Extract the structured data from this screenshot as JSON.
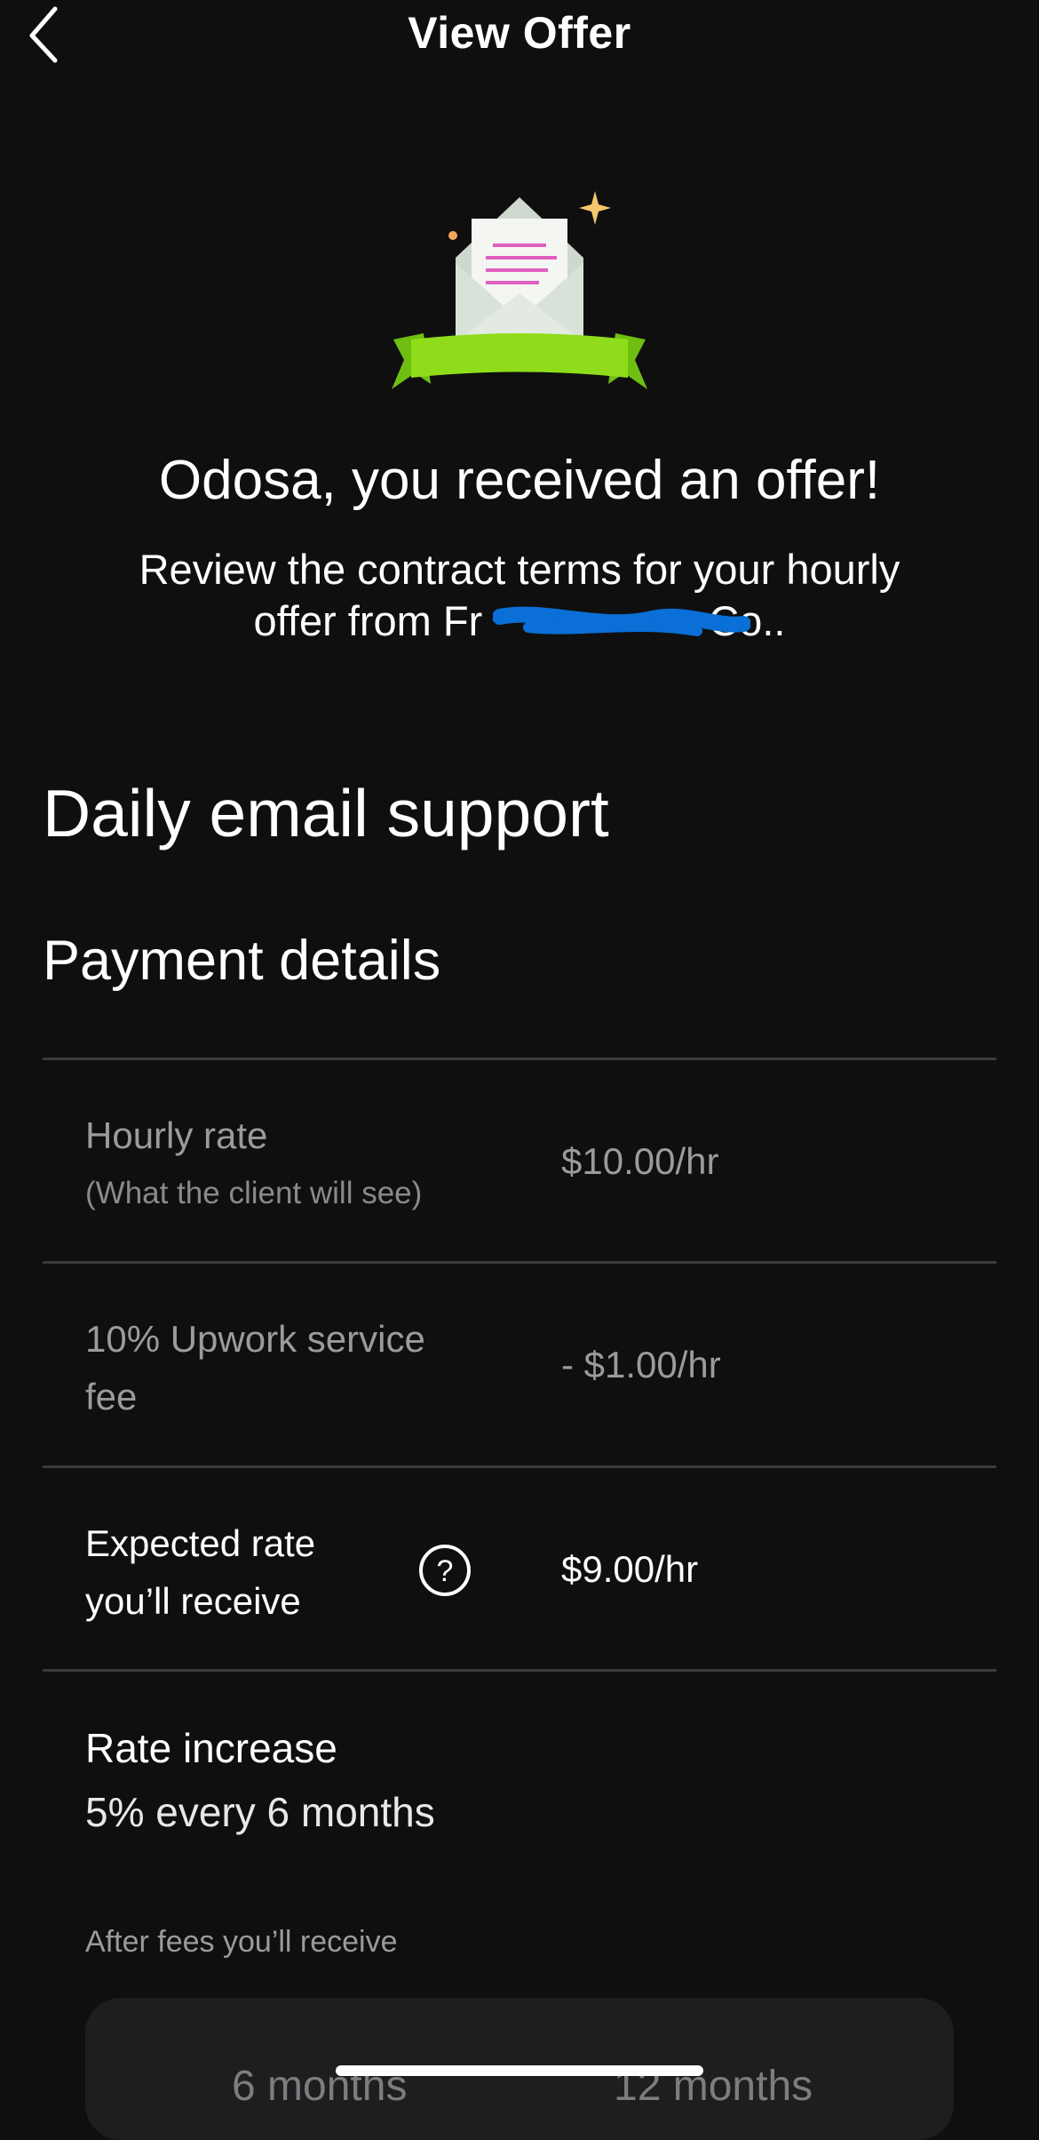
{
  "header": {
    "title": "View Offer",
    "back_icon": "chevron-left-icon"
  },
  "hero": {
    "illustration": "envelope-with-ribbon-icon",
    "ribbon_color": "#8fdd1a"
  },
  "offer": {
    "headline": "Odosa, you received an offer!",
    "subtitle_line1": "Review the contract terms for your hourly",
    "subtitle_line2": "offer from Fr",
    "subtitle_suffix": "Co.."
  },
  "job": {
    "title": "Daily email support"
  },
  "payment": {
    "section_title": "Payment details",
    "hourly_rate_label": "Hourly rate",
    "hourly_rate_note": "(What the client will see)",
    "hourly_rate_value": "$10.00/hr",
    "fee_label_line1": "10% Upwork service",
    "fee_label_line2": "fee",
    "fee_value": "- $1.00/hr",
    "expected_label_line1": "Expected rate",
    "expected_label_line2": "you’ll receive",
    "expected_value": "$9.00/hr",
    "help_icon": "question-circle-icon"
  },
  "rate_increase": {
    "title": "Rate increase",
    "value": "5% every 6 months",
    "after_fees_label": "After fees you’ll receive",
    "period_1": "6 months",
    "period_2": "12 months"
  },
  "colors": {
    "background": "#0f0f10",
    "redaction": "#0a6fd6",
    "divider": "#3a3a3c"
  }
}
